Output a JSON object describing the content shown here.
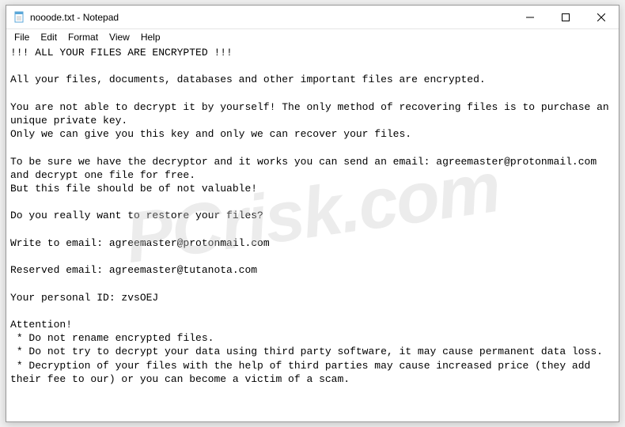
{
  "titlebar": {
    "title": "nooode.txt - Notepad"
  },
  "menubar": {
    "items": [
      "File",
      "Edit",
      "Format",
      "View",
      "Help"
    ]
  },
  "content": {
    "text": "!!! ALL YOUR FILES ARE ENCRYPTED !!!\n\nAll your files, documents, databases and other important files are encrypted.\n\nYou are not able to decrypt it by yourself! The only method of recovering files is to purchase an unique private key.\nOnly we can give you this key and only we can recover your files.\n\nTo be sure we have the decryptor and it works you can send an email: agreemaster@protonmail.com  and decrypt one file for free.\nBut this file should be of not valuable!\n\nDo you really want to restore your files?\n\nWrite to email: agreemaster@protonmail.com\n\nReserved email: agreemaster@tutanota.com\n\nYour personal ID: zvsOEJ\n\nAttention!\n * Do not rename encrypted files.\n * Do not try to decrypt your data using third party software, it may cause permanent data loss.\n * Decryption of your files with the help of third parties may cause increased price (they add their fee to our) or you can become a victim of a scam.\n"
  },
  "watermark": {
    "text": "PCrisk.com"
  }
}
